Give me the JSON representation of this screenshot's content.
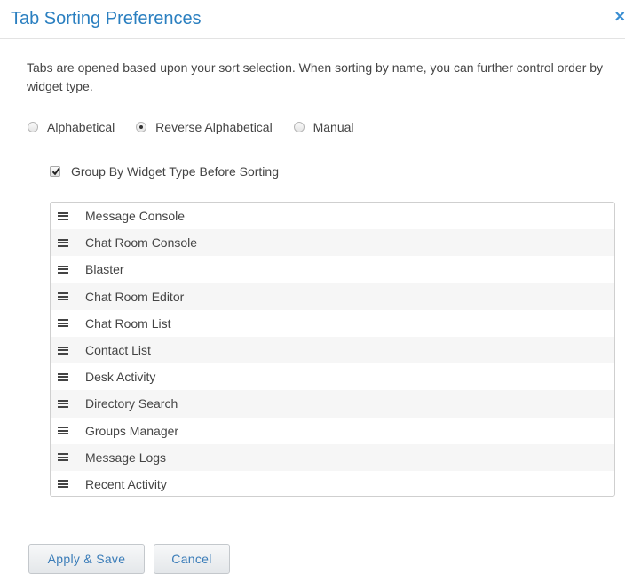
{
  "dialog": {
    "title": "Tab Sorting Preferences",
    "close_glyph": "×",
    "description": "Tabs are opened based upon your sort selection. When sorting by name, you can further control order by widget type."
  },
  "sort_options": {
    "selected": "Reverse Alphabetical",
    "items": [
      {
        "label": "Alphabetical",
        "checked": false
      },
      {
        "label": "Reverse Alphabetical",
        "checked": true
      },
      {
        "label": "Manual",
        "checked": false
      }
    ]
  },
  "group_by": {
    "label": "Group By Widget Type Before Sorting",
    "checked": true
  },
  "widgets": [
    "Message Console",
    "Chat Room Console",
    "Blaster",
    "Chat Room Editor",
    "Chat Room List",
    "Contact List",
    "Desk Activity",
    "Directory Search",
    "Groups Manager",
    "Message Logs",
    "Recent Activity"
  ],
  "buttons": {
    "apply": "Apply & Save",
    "cancel": "Cancel"
  },
  "colors": {
    "title": "#2a7fc0",
    "button_text": "#3a7cb8",
    "close_icon": "#3a8ed2"
  },
  "icons": {
    "close": "close-icon",
    "drag_handle": "drag-handle-icon",
    "check": "checkmark-icon"
  }
}
